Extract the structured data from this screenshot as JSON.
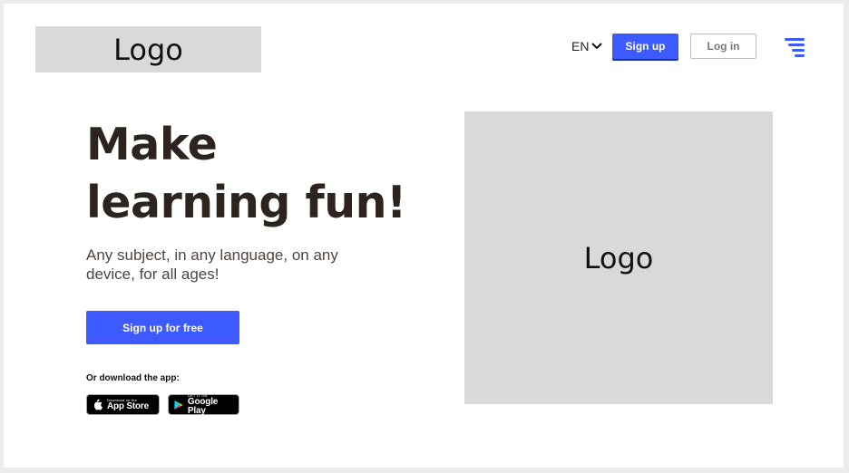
{
  "header": {
    "logo_text": "Logo",
    "language": "EN",
    "signup_label": "Sign up",
    "login_label": "Log in",
    "menu_icon": "hamburger-menu-icon"
  },
  "hero": {
    "headline": "Make learning fun!",
    "subtitle": "Any subject, in any language, on any device, for all ages!",
    "cta_label": "Sign up for free",
    "download_label": "Or download the app:",
    "app_store": {
      "small": "Download on the",
      "big": "App Store"
    },
    "google_play": {
      "small": "GET IT ON",
      "big": "Google Play"
    },
    "image_placeholder": "Logo"
  },
  "colors": {
    "accent": "#3d5afe",
    "headline": "#2d241f",
    "placeholder_bg": "#d9d9d9"
  }
}
